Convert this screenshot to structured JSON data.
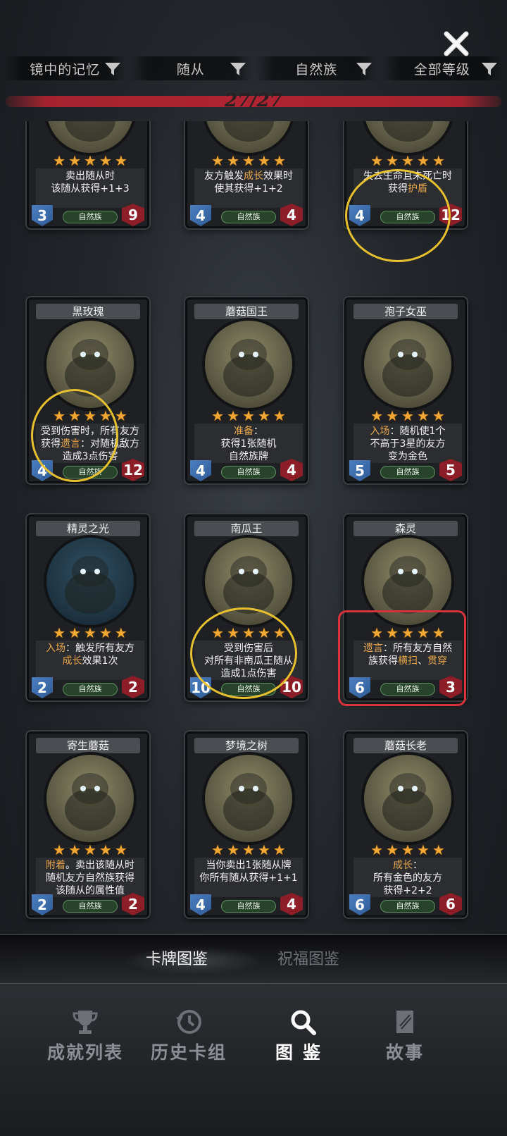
{
  "filters": [
    {
      "label": "镜中的记忆",
      "icon": "funnel-icon"
    },
    {
      "label": "随从",
      "icon": "funnel-icon"
    },
    {
      "label": "自然族",
      "icon": "funnel-icon"
    },
    {
      "label": "全部等级",
      "icon": "funnel-icon"
    }
  ],
  "counter": "27/27",
  "cards": [
    {
      "name": "",
      "desc_lines": [
        "卖出随从时",
        "该随从获得+1+3"
      ],
      "attack": "3",
      "health": "9",
      "tribe": "自然族",
      "stars": 5
    },
    {
      "name": "",
      "desc_lines": [
        "友方触发成长效果时",
        "使其获得+1+2"
      ],
      "attack": "4",
      "health": "4",
      "tribe": "自然族",
      "stars": 5
    },
    {
      "name": "",
      "desc_lines": [
        "失去生命且未死亡时",
        "获得护盾"
      ],
      "attack": "4",
      "health": "12",
      "tribe": "自然族",
      "stars": 5
    },
    {
      "name": "黑玫瑰",
      "desc_lines": [
        "受到伤害时，所有友方",
        "获得遗言：对随机敌方",
        "造成3点伤害"
      ],
      "attack": "4",
      "health": "12",
      "tribe": "自然族",
      "stars": 5
    },
    {
      "name": "蘑菇国王",
      "desc_lines": [
        "准备：",
        "获得1张随机",
        "自然族牌"
      ],
      "attack": "4",
      "health": "4",
      "tribe": "自然族",
      "stars": 5
    },
    {
      "name": "孢子女巫",
      "desc_lines": [
        "入场：随机使1个",
        "不高于3星的友方",
        "变为金色"
      ],
      "attack": "5",
      "health": "5",
      "tribe": "自然族",
      "stars": 5
    },
    {
      "name": "精灵之光",
      "desc_lines": [
        "入场：触发所有友方",
        "成长效果1次"
      ],
      "attack": "2",
      "health": "2",
      "tribe": "自然族",
      "stars": 5
    },
    {
      "name": "南瓜王",
      "desc_lines": [
        "受到伤害后",
        "对所有非南瓜王随从",
        "造成1点伤害"
      ],
      "attack": "10",
      "health": "10",
      "tribe": "自然族",
      "stars": 5
    },
    {
      "name": "森灵",
      "desc_lines": [
        "遗言：所有友方自然",
        "族获得横扫、贯穿"
      ],
      "attack": "6",
      "health": "3",
      "tribe": "自然族",
      "stars": 5
    },
    {
      "name": "寄生蘑菇",
      "desc_lines": [
        "附着。卖出该随从时",
        "随机友方自然族获得",
        "该随从的属性值"
      ],
      "attack": "2",
      "health": "2",
      "tribe": "自然族",
      "stars": 5
    },
    {
      "name": "梦境之树",
      "desc_lines": [
        "当你卖出1张随从牌",
        "你所有随从获得+1+1"
      ],
      "attack": "4",
      "health": "4",
      "tribe": "自然族",
      "stars": 5
    },
    {
      "name": "蘑菇长老",
      "desc_lines": [
        "成长：",
        "所有金色的友方",
        "获得+2+2"
      ],
      "attack": "6",
      "health": "6",
      "tribe": "自然族",
      "stars": 5
    }
  ],
  "subtabs": [
    {
      "label": "卡牌图鉴",
      "active": true
    },
    {
      "label": "祝福图鉴",
      "active": false
    }
  ],
  "nav": [
    {
      "label": "成就列表",
      "icon": "trophy-icon",
      "active": false
    },
    {
      "label": "历史卡组",
      "icon": "history-clock-icon",
      "active": false
    },
    {
      "label": "图鉴",
      "icon": "magnifier-icon",
      "active": true
    },
    {
      "label": "故事",
      "icon": "book-icon",
      "active": false
    }
  ],
  "colors": {
    "star": "#f2a834",
    "highlight_text": "#e9a64a",
    "attack_badge": "#3f72b3",
    "health_badge": "#8d1d26",
    "tribe_pill": "#27442a",
    "counter_stroke": "#b02432",
    "annotation_yellow": "#e6c02e",
    "annotation_red": "#d8323c"
  }
}
